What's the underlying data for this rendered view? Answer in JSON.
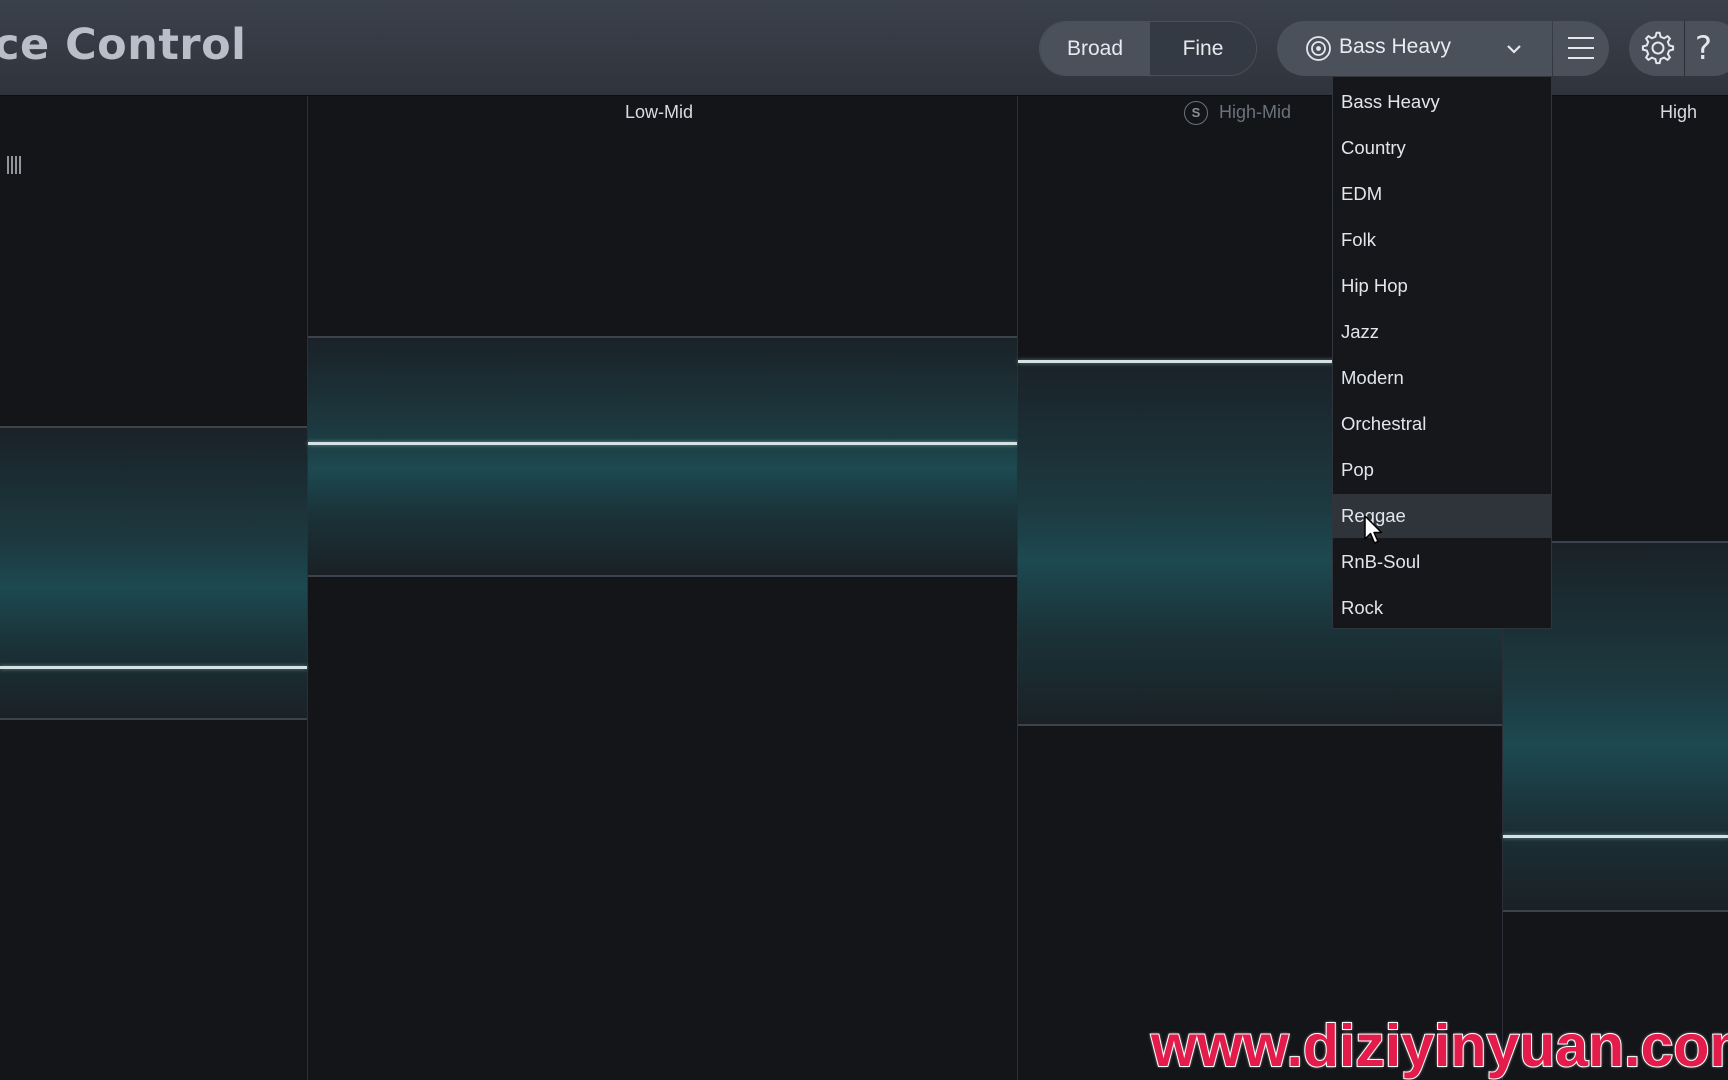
{
  "header": {
    "title": "ce Control",
    "mode_toggle": {
      "broad_label": "Broad",
      "fine_label": "Fine",
      "selected": "Broad"
    },
    "preset": {
      "selected_label": "Bass Heavy"
    },
    "buttons": {
      "help_label": "?"
    }
  },
  "bands": [
    {
      "label": ""
    },
    {
      "label": "Low-Mid"
    },
    {
      "label": "High-Mid",
      "solo_label": "S",
      "dimmed": true
    },
    {
      "label": "High"
    }
  ],
  "dropdown": {
    "options": [
      "Bass Heavy",
      "Country",
      "EDM",
      "Folk",
      "Hip Hop",
      "Jazz",
      "Modern",
      "Orchestral",
      "Pop",
      "Reggae",
      "RnB-Soul",
      "Rock"
    ],
    "hovered": "Reggae"
  },
  "watermark": "www.diziyinyuan.com",
  "colors": {
    "accent_teal": "#1d4950",
    "header_bg": "#353b44",
    "panel_bg": "#131519",
    "watermark": "#e41c4b"
  },
  "icons": [
    "target-icon",
    "chevron-down-icon",
    "hamburger-menu-icon",
    "gear-icon",
    "help-icon",
    "solo-icon",
    "meter-icon",
    "mouse-cursor-icon"
  ]
}
